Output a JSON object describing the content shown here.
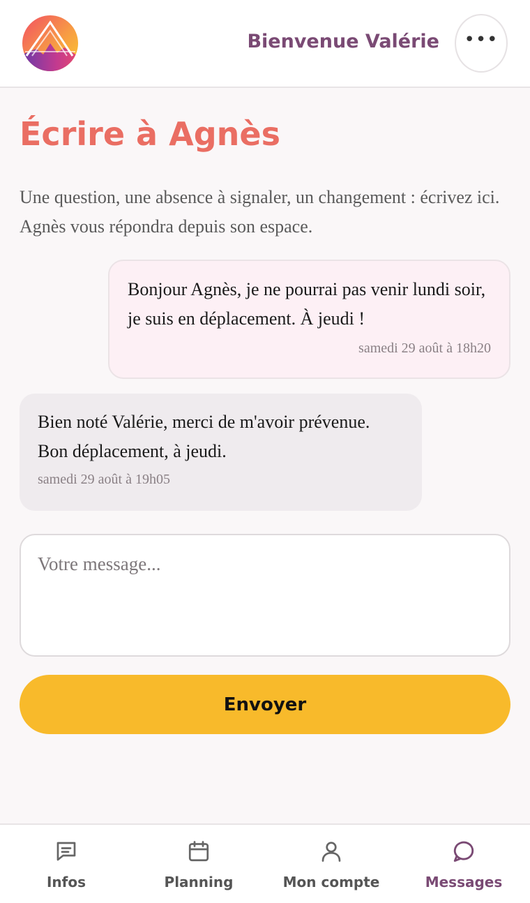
{
  "header": {
    "welcome": "Bienvenue Valérie",
    "menu_glyph": "•••",
    "logo_icon": "mountain-logo-icon"
  },
  "main": {
    "title": "Écrire à Agnès",
    "intro": "Une question, une absence à signaler, un changement : écrivez ici. Agnès vous répondra depuis son espace."
  },
  "messages": [
    {
      "direction": "outgoing",
      "text": "Bonjour Agnès, je ne pourrai pas venir lundi soir, je suis en déplacement. À jeudi !",
      "time": "samedi 29 août à 18h20"
    },
    {
      "direction": "incoming",
      "text": "Bien noté Valérie, merci de m'avoir prévenue. Bon déplacement, à jeudi.",
      "time": "samedi 29 août à 19h05"
    }
  ],
  "composer": {
    "placeholder": "Votre message...",
    "value": "",
    "send_label": "Envoyer"
  },
  "nav": {
    "items": [
      {
        "label": "Infos",
        "icon": "message-square-icon",
        "active": false
      },
      {
        "label": "Planning",
        "icon": "calendar-icon",
        "active": false
      },
      {
        "label": "Mon compte",
        "icon": "user-icon",
        "active": false
      },
      {
        "label": "Messages",
        "icon": "message-circle-icon",
        "active": true
      }
    ]
  },
  "colors": {
    "accent": "#7a4a74",
    "title": "#ea6e63",
    "button": "#f8ba2b",
    "outgoing_bubble": "#fdf0f5",
    "incoming_bubble": "#efebee",
    "background": "#faf7f8"
  }
}
